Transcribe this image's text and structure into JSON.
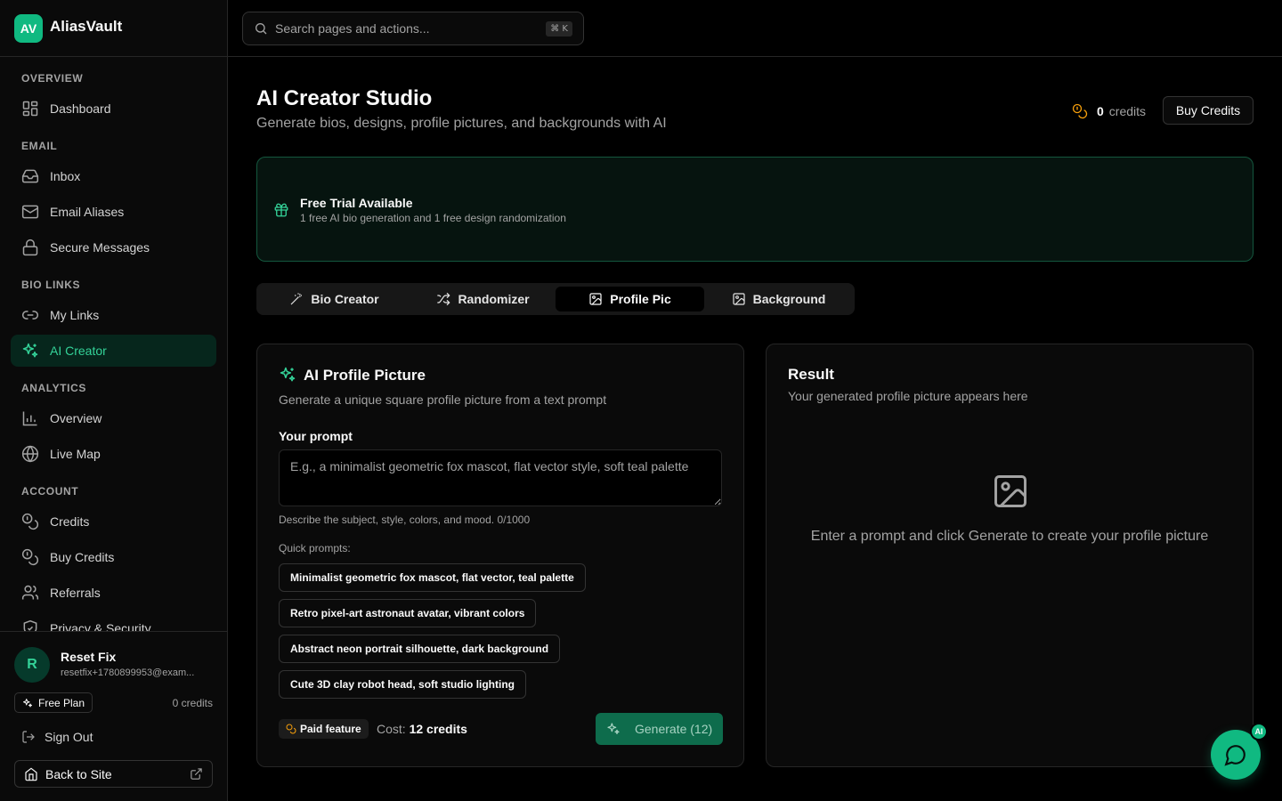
{
  "brand": {
    "logo": "AV",
    "name": "AliasVault"
  },
  "nav": {
    "sections": {
      "overview": "OVERVIEW",
      "email": "EMAIL",
      "bio_links": "BIO LINKS",
      "analytics": "ANALYTICS",
      "account": "ACCOUNT"
    },
    "items": {
      "dashboard": "Dashboard",
      "inbox": "Inbox",
      "email_aliases": "Email Aliases",
      "secure_messages": "Secure Messages",
      "my_links": "My Links",
      "ai_creator": "AI Creator",
      "analytics_overview": "Overview",
      "live_map": "Live Map",
      "credits": "Credits",
      "buy_credits": "Buy Credits",
      "referrals": "Referrals",
      "privacy_security": "Privacy & Security"
    },
    "active": "ai_creator"
  },
  "user": {
    "initial": "R",
    "name": "Reset Fix",
    "email": "resetfix+1780899953@exam...",
    "plan": "Free Plan",
    "credits": "0 credits",
    "sign_out": "Sign Out",
    "back_to_site": "Back to Site"
  },
  "search": {
    "placeholder": "Search pages and actions...",
    "shortcut": "⌘ K"
  },
  "page": {
    "title": "AI Creator Studio",
    "subtitle": "Generate bios, designs, profile pictures, and backgrounds with AI",
    "credits_value": "0",
    "credits_label": "credits",
    "buy_credits": "Buy Credits"
  },
  "banner": {
    "title": "Free Trial Available",
    "description": "1 free AI bio generation and 1 free design randomization"
  },
  "tabs": [
    "Bio Creator",
    "Randomizer",
    "Profile Pic",
    "Background"
  ],
  "active_tab": "Profile Pic",
  "generator": {
    "title": "AI Profile Picture",
    "description": "Generate a unique square profile picture from a text prompt",
    "prompt_label": "Your prompt",
    "prompt_value": "",
    "prompt_placeholder": "E.g., a minimalist geometric fox mascot, flat vector style, soft teal palette",
    "help": "Describe the subject, style, colors, and mood. 0/1000",
    "quick_label": "Quick prompts:",
    "quick_prompts": [
      "Minimalist geometric fox mascot, flat vector, teal palette",
      "Retro pixel-art astronaut avatar, vibrant colors",
      "Abstract neon portrait silhouette, dark background",
      "Cute 3D clay robot head, soft studio lighting"
    ],
    "paid_badge": "Paid feature",
    "cost_label": "Cost:",
    "cost_value": "12 credits",
    "generate_button": "Generate (12)"
  },
  "result": {
    "title": "Result",
    "description": "Your generated profile picture appears here",
    "placeholder": "Enter a prompt and click Generate to create your profile picture"
  },
  "chat": {
    "badge": "AI"
  },
  "colors": {
    "accent": "#10b981",
    "accent_text": "#34d399",
    "background": "#000000",
    "surface": "#0a0a0a",
    "border": "#262626",
    "credit_coin": "#f59e0b"
  }
}
